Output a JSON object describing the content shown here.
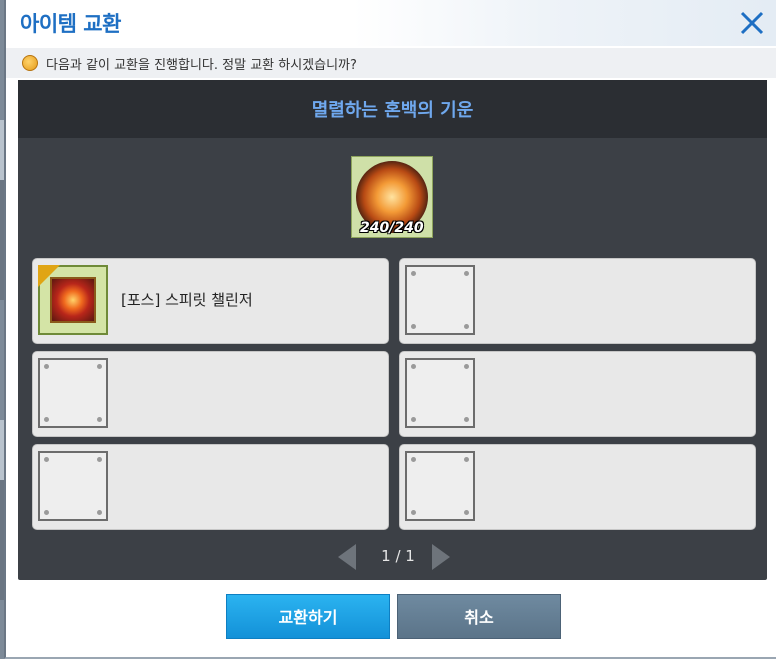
{
  "dialog": {
    "title": "아이템 교환",
    "message": "다음과 같이 교환을 진행합니다. 정말 교환 하시겠습니까?",
    "panel_title": "멸렬하는 혼백의 기운",
    "main_item": {
      "icon": "flame-orb-icon",
      "count": "240/240"
    },
    "slots": [
      {
        "label": "[포스] 스피릿 챌린저",
        "icon": "spirit-challenger-icon",
        "filled": true
      },
      {
        "label": "",
        "filled": false
      },
      {
        "label": "",
        "filled": false
      },
      {
        "label": "",
        "filled": false
      },
      {
        "label": "",
        "filled": false
      },
      {
        "label": "",
        "filled": false
      }
    ],
    "pager": {
      "text": "1 / 1"
    },
    "buttons": {
      "confirm": "교환하기",
      "cancel": "취소"
    }
  },
  "colors": {
    "title": "#1e6fc3",
    "panel_title": "#6fa8ee",
    "confirm": "#1391d8",
    "cancel": "#5b7489"
  }
}
